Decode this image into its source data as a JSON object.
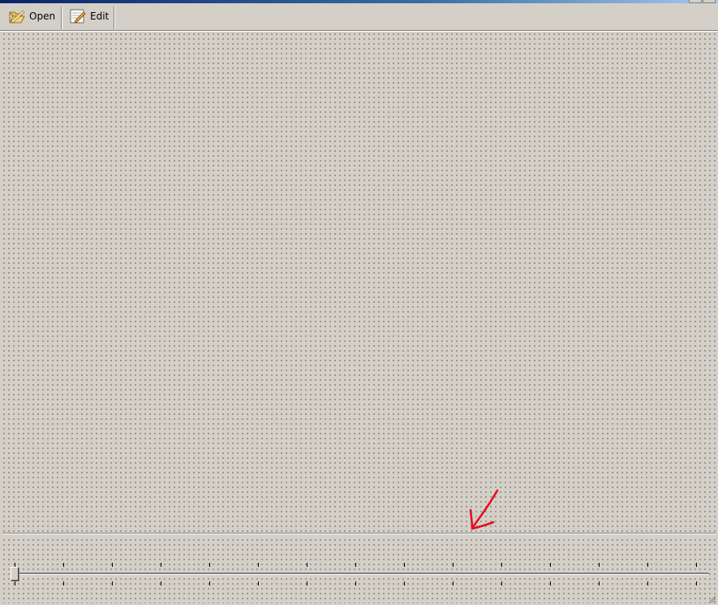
{
  "toolbar": {
    "open_label": "Open",
    "edit_label": "Edit"
  },
  "icons": {
    "open": "folder-open-icon",
    "edit": "pencil-edit-icon",
    "grip": "resize-grip-icon"
  },
  "slider": {
    "min": 0,
    "max": 14,
    "value": 0,
    "tick_count": 15
  },
  "colors": {
    "background": "#d4d0c8",
    "annotation": "#e3121f"
  }
}
